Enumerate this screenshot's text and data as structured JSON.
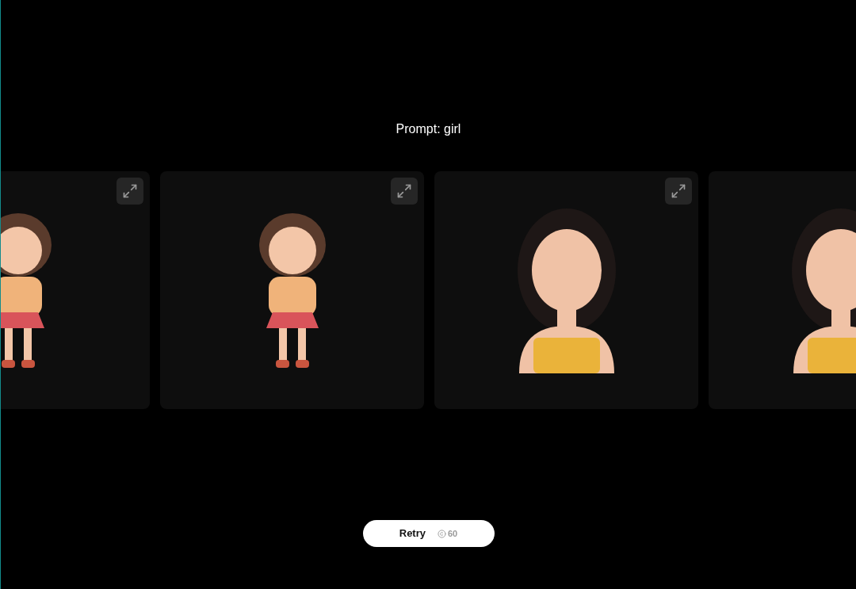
{
  "prompt": "Prompt: girl",
  "cards": [
    {
      "kind": "full-body"
    },
    {
      "kind": "full-body"
    },
    {
      "kind": "bust"
    },
    {
      "kind": "bust"
    }
  ],
  "retry_button": {
    "label": "Retry",
    "cost": "60"
  }
}
